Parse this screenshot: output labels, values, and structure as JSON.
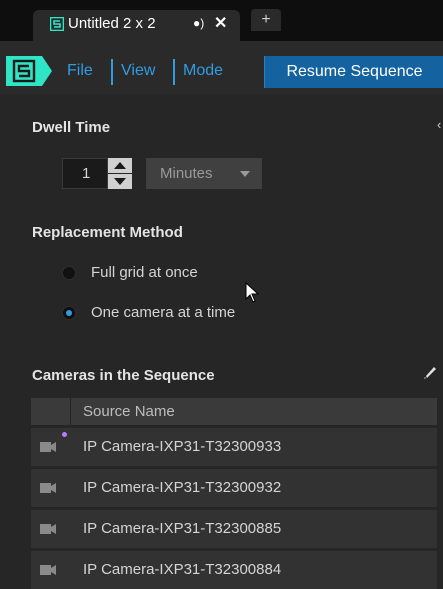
{
  "tab": {
    "title": "Untitled 2 x 2",
    "audio_icon": "speaker-icon",
    "close_icon": "close-icon",
    "add_label": "+"
  },
  "menu": {
    "logo_icon": "app-logo-icon",
    "items": [
      "File",
      "View",
      "Mode"
    ],
    "resume_label": "Resume Sequence"
  },
  "dwell": {
    "title": "Dwell Time",
    "value": "1",
    "unit": "Minutes"
  },
  "replacement": {
    "title": "Replacement Method",
    "options": [
      {
        "label": "Full grid at once",
        "checked": false
      },
      {
        "label": "One camera at a time",
        "checked": true
      }
    ]
  },
  "cameras": {
    "title": "Cameras in the Sequence",
    "column_header": "Source Name",
    "rows": [
      {
        "name": "IP Camera-IXP31-T32300933",
        "dot": true
      },
      {
        "name": "IP Camera-IXP31-T32300932",
        "dot": false
      },
      {
        "name": "IP Camera-IXP31-T32300885",
        "dot": false
      },
      {
        "name": "IP Camera-IXP31-T32300884",
        "dot": false
      }
    ]
  },
  "colors": {
    "accent": "#2f9de3",
    "brand_logo": "#2ee6c5",
    "button": "#1463a0",
    "status_dot": "#b57cff"
  }
}
